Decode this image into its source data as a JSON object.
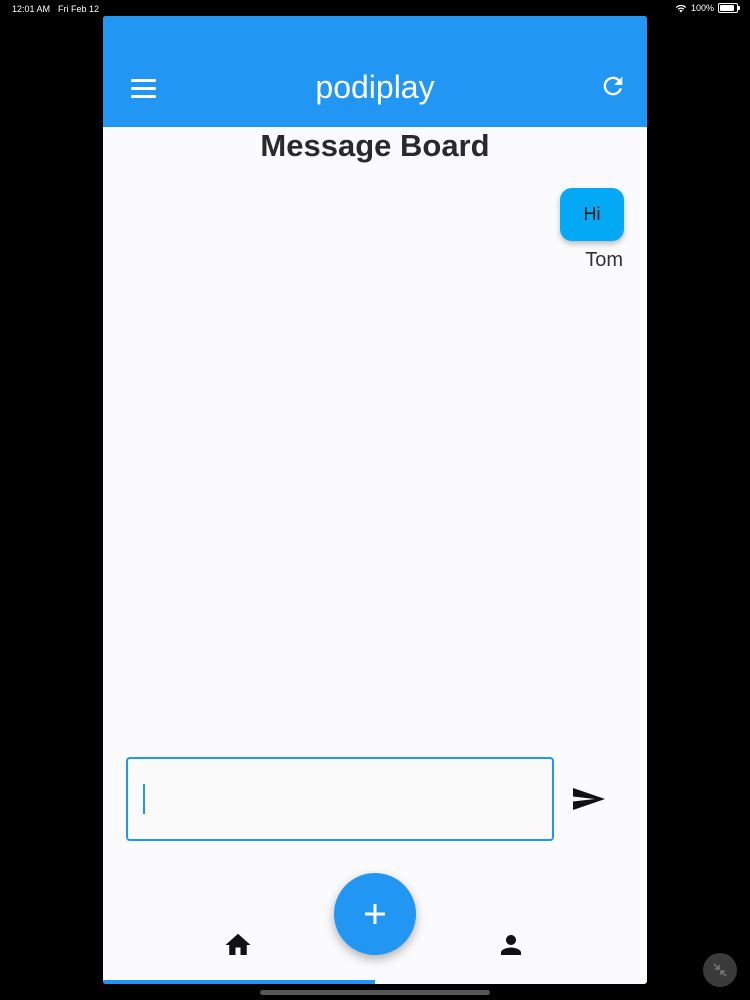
{
  "status_bar": {
    "time": "12:01 AM",
    "date": "Fri Feb 12",
    "battery": "100%",
    "battery_level": 1.0,
    "wifi_icon": "wifi-icon"
  },
  "app_bar": {
    "title": "podiplay",
    "menu_icon": "menu-icon",
    "refresh_icon": "refresh-icon",
    "background": "#2196f3"
  },
  "page": {
    "title": "Message Board"
  },
  "messages": [
    {
      "text": "Hi",
      "sender": "Tom",
      "bubble_color": "#03a9f4"
    }
  ],
  "composer": {
    "value": "",
    "send_icon": "send-icon"
  },
  "bottom_nav": {
    "fab_icon": "plus-icon",
    "home_icon": "home-icon",
    "profile_icon": "person-icon",
    "active_tab": "home"
  },
  "colors": {
    "accent": "#2196f3",
    "bubble": "#03a9f4"
  }
}
